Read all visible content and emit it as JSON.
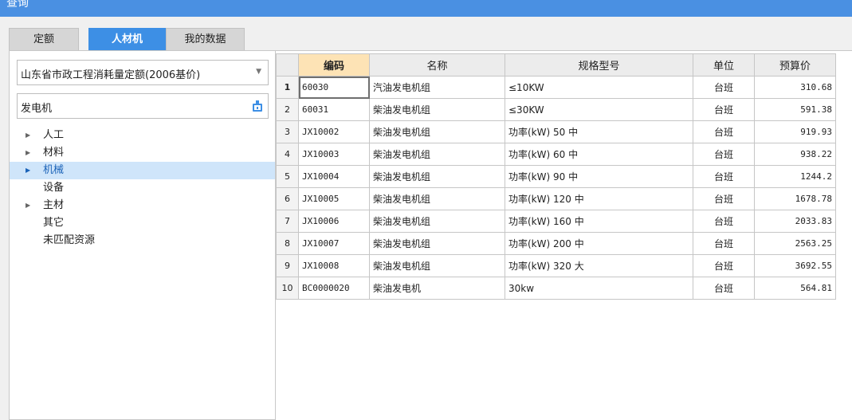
{
  "window": {
    "title": "查询"
  },
  "tabs": [
    {
      "label": "定额",
      "active": false
    },
    {
      "label": "人材机",
      "active": true
    },
    {
      "label": "我的数据",
      "active": false
    }
  ],
  "left": {
    "library_select": {
      "value": "山东省市政工程消耗量定额(2006基价)"
    },
    "search_input": {
      "value": "发电机",
      "icon": "search-book-icon"
    },
    "tree": [
      {
        "label": "人工",
        "expandable": true,
        "selected": false
      },
      {
        "label": "材料",
        "expandable": true,
        "selected": false
      },
      {
        "label": "机械",
        "expandable": true,
        "selected": true
      },
      {
        "label": "设备",
        "expandable": false,
        "selected": false
      },
      {
        "label": "主材",
        "expandable": true,
        "selected": false
      },
      {
        "label": "其它",
        "expandable": false,
        "selected": false
      },
      {
        "label": "未匹配资源",
        "expandable": false,
        "selected": false
      }
    ]
  },
  "table": {
    "columns": [
      "编码",
      "名称",
      "规格型号",
      "单位",
      "预算价"
    ],
    "rows": [
      {
        "n": "1",
        "code": "60030",
        "name": "汽油发电机组",
        "spec": "≤10KW",
        "unit": "台班",
        "price": "310.68"
      },
      {
        "n": "2",
        "code": "60031",
        "name": "柴油发电机组",
        "spec": "≤30KW",
        "unit": "台班",
        "price": "591.38"
      },
      {
        "n": "3",
        "code": "JX10002",
        "name": "柴油发电机组",
        "spec": "功率(kW) 50 中",
        "unit": "台班",
        "price": "919.93"
      },
      {
        "n": "4",
        "code": "JX10003",
        "name": "柴油发电机组",
        "spec": "功率(kW) 60 中",
        "unit": "台班",
        "price": "938.22"
      },
      {
        "n": "5",
        "code": "JX10004",
        "name": "柴油发电机组",
        "spec": "功率(kW) 90 中",
        "unit": "台班",
        "price": "1244.2"
      },
      {
        "n": "6",
        "code": "JX10005",
        "name": "柴油发电机组",
        "spec": "功率(kW) 120 中",
        "unit": "台班",
        "price": "1678.78"
      },
      {
        "n": "7",
        "code": "JX10006",
        "name": "柴油发电机组",
        "spec": "功率(kW) 160 中",
        "unit": "台班",
        "price": "2033.83"
      },
      {
        "n": "8",
        "code": "JX10007",
        "name": "柴油发电机组",
        "spec": "功率(kW) 200 中",
        "unit": "台班",
        "price": "2563.25"
      },
      {
        "n": "9",
        "code": "JX10008",
        "name": "柴油发电机组",
        "spec": "功率(kW) 320 大",
        "unit": "台班",
        "price": "3692.55"
      },
      {
        "n": "10",
        "code": "BC0000020",
        "name": "柴油发电机",
        "spec": "30kw",
        "unit": "台班",
        "price": "564.81"
      }
    ],
    "selected_row": 0
  },
  "colors": {
    "titlebar": "#4a90e2",
    "active_tab": "#3d8fe5",
    "selected_tree": "#cfe5fa",
    "code_header": "#fde3b5"
  }
}
